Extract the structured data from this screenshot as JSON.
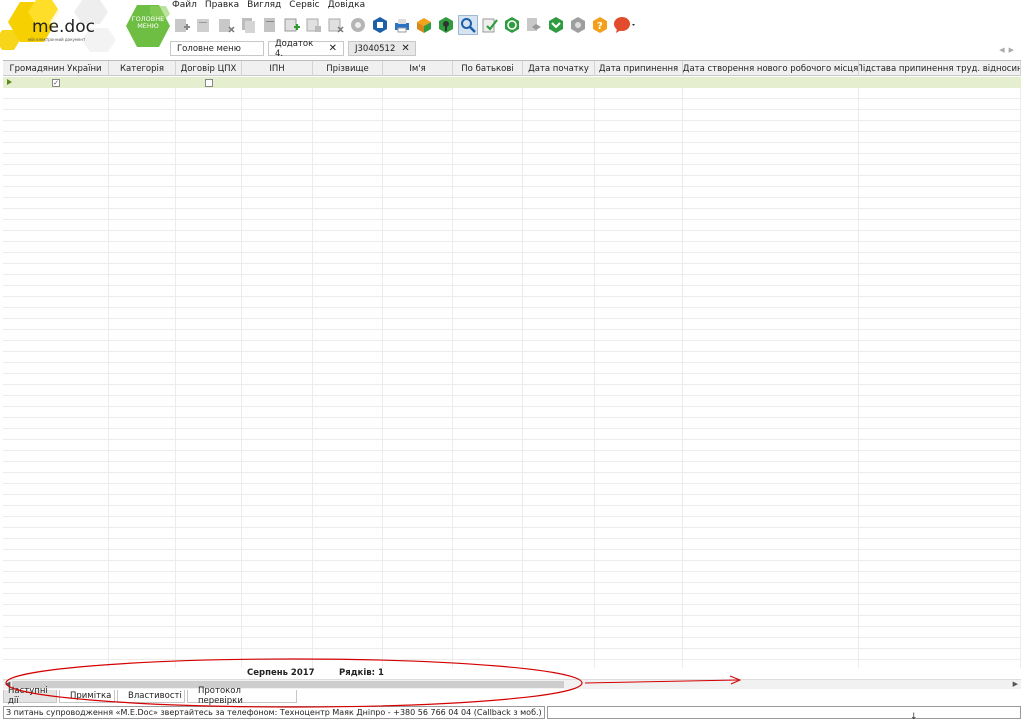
{
  "app": {
    "logo_text": "me.doc",
    "logo_tagline": "мій електронний документ",
    "home_button_label": "ГОЛОВНЕ МЕНЮ"
  },
  "menu": [
    "Файл",
    "Правка",
    "Вигляд",
    "Сервіс",
    "Довідка"
  ],
  "toolbar": [
    "new-doc-icon",
    "open-doc-icon",
    "delete-doc-icon",
    "copy-doc-icon",
    "copy-doc-2-icon",
    "add-row-icon",
    "edit-row-icon",
    "delete-row-icon",
    "settings-gear-icon",
    "save-icon",
    "print-icon",
    "send-icon",
    "sign-icon",
    "search-icon",
    "check-icon",
    "refresh-icon",
    "package-icon",
    "receive-icon",
    "module-icon",
    "help-icon",
    "chat-icon"
  ],
  "tabs": [
    {
      "label": "Головне меню",
      "closable": false
    },
    {
      "label": "Додаток 4.",
      "closable": true
    },
    {
      "label": "J3040512",
      "closable": true,
      "active": true
    }
  ],
  "grid": {
    "columns": [
      "Громадянин України",
      "Категорія",
      "Договір ЦПХ",
      "ІПН",
      "Прізвище",
      "Ім'я",
      "По батькові",
      "Дата початку",
      "Дата припинення",
      "Дата створення нового робочого місця",
      "Підстава припинення труд. відносин"
    ],
    "rows": [
      {
        "citizen_checked": true,
        "gph_checked": false
      }
    ]
  },
  "footer": {
    "period": "Серпень 2017",
    "rows_count": "Рядків: 1"
  },
  "bottom_tabs": [
    "Наступні дії",
    "Примітка",
    "Властивості",
    "Протокол перевірки"
  ],
  "status": {
    "message": "З питань супроводження «M.E.Doc» звертайтесь за телефоном: Техноцентр Маяк Дніпро - +380 56 766 04 04 (Callback з моб.)"
  },
  "colors": {
    "accent_green": "#6fbe44",
    "logo_yellow": "#f6d000",
    "selected_row": "#e5efcf",
    "annotation": "#d40000"
  }
}
